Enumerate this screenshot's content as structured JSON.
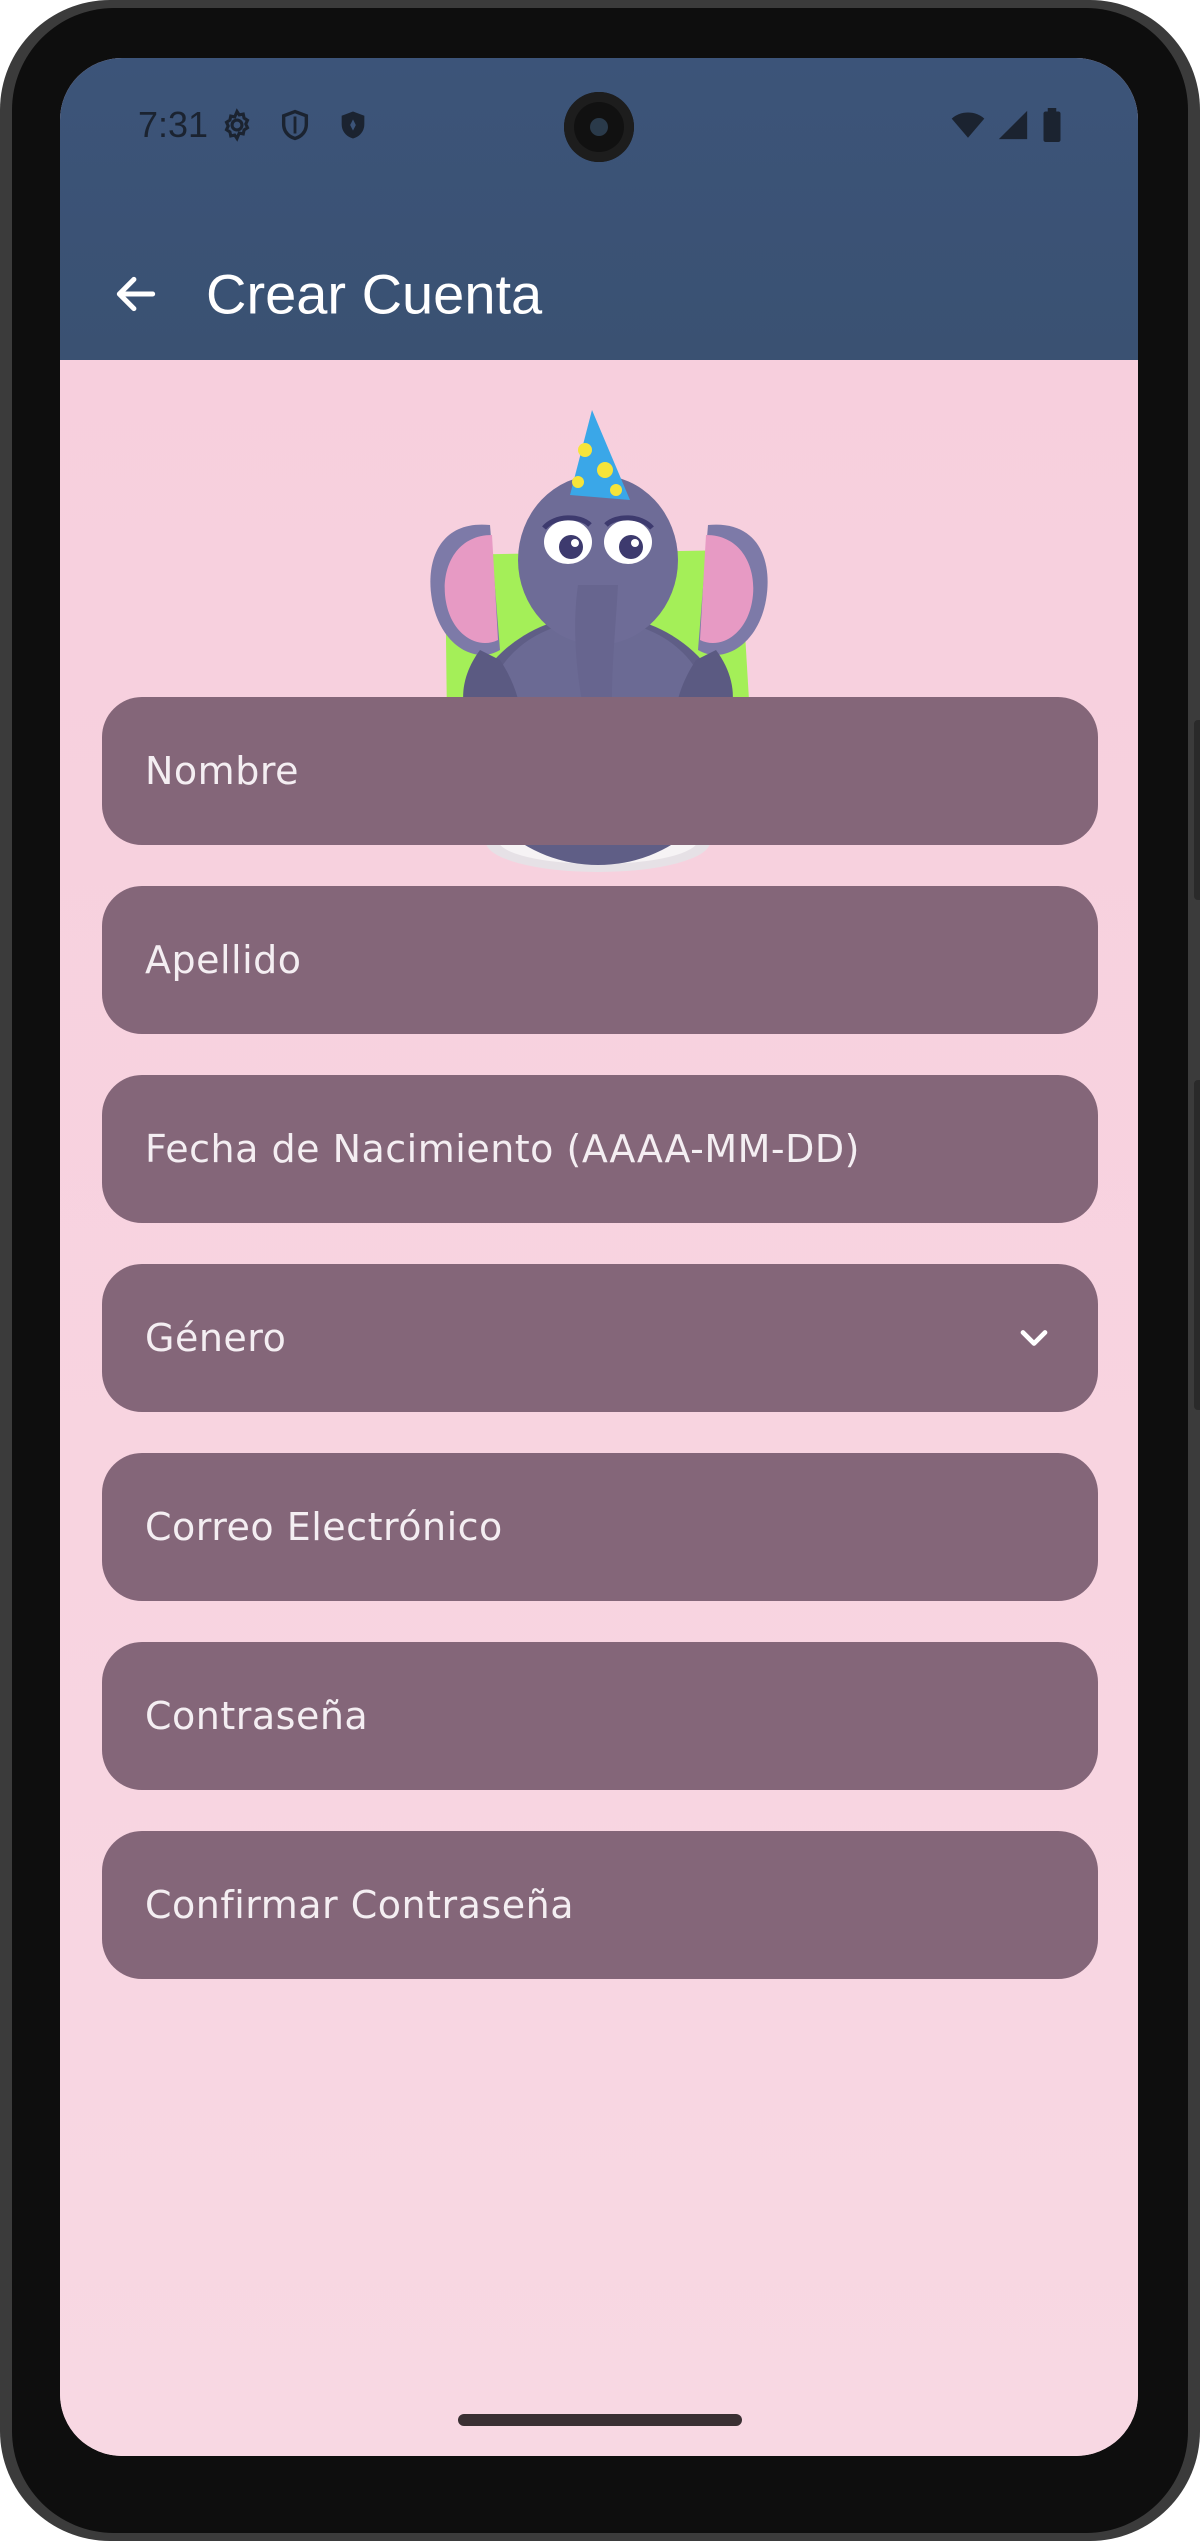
{
  "status_bar": {
    "time": "7:31",
    "left_icons": [
      "settings-gear-icon",
      "shield-outline-icon",
      "shield-filled-icon"
    ],
    "right_icons": [
      "wifi-icon",
      "signal-icon",
      "battery-icon"
    ]
  },
  "app_bar": {
    "title": "Crear Cuenta",
    "back_icon": "arrow-back-icon",
    "background_color": "#3c5479"
  },
  "illustration": {
    "subject": "elephant-with-party-hat-and-birthday-cake"
  },
  "form": {
    "fields": [
      {
        "label": "Nombre",
        "type": "text"
      },
      {
        "label": "Apellido",
        "type": "text"
      },
      {
        "label": "Fecha de Nacimiento (AAAA-MM-DD)",
        "type": "date"
      },
      {
        "label": "Género",
        "type": "dropdown"
      },
      {
        "label": "Correo Electrónico",
        "type": "email"
      },
      {
        "label": "Contraseña",
        "type": "password"
      },
      {
        "label": "Confirmar Contraseña",
        "type": "password"
      }
    ],
    "field_color": "#846679",
    "background_color": "#f7cfdd"
  }
}
